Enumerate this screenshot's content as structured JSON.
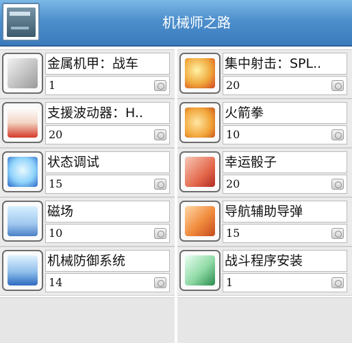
{
  "window": {
    "title": "机械师之路"
  },
  "skills": [
    {
      "name": "金属机甲：战车",
      "level": "1",
      "icon": "metal-mech-tank-icon",
      "colors": [
        "#e9e9e9",
        "#5a5a5a"
      ]
    },
    {
      "name": "集中射击：SPL..",
      "level": "20",
      "icon": "focused-shot-icon",
      "colors": [
        "#f8c34a",
        "#d2441f"
      ]
    },
    {
      "name": "支援波动器：H..",
      "level": "20",
      "icon": "support-wave-icon",
      "colors": [
        "#f7e7d8",
        "#d53a2a"
      ]
    },
    {
      "name": "火箭拳",
      "level": "10",
      "icon": "rocket-punch-icon",
      "colors": [
        "#ffe7a3",
        "#e07b21"
      ]
    },
    {
      "name": "状态调试",
      "level": "15",
      "icon": "status-debug-icon",
      "colors": [
        "#a9e4ff",
        "#2a67c8"
      ]
    },
    {
      "name": "幸运骰子",
      "level": "20",
      "icon": "lucky-dice-icon",
      "colors": [
        "#f6c8b8",
        "#cf3b2d"
      ]
    },
    {
      "name": "磁场",
      "level": "10",
      "icon": "magnetic-field-icon",
      "colors": [
        "#d8f0ff",
        "#4b80c7"
      ]
    },
    {
      "name": "导航辅助导弹",
      "level": "15",
      "icon": "homing-missile-icon",
      "colors": [
        "#ffd8a6",
        "#e0622a"
      ]
    },
    {
      "name": "机械防御系统",
      "level": "14",
      "icon": "defense-system-icon",
      "colors": [
        "#bfe1ff",
        "#2e6bc0"
      ]
    },
    {
      "name": "战斗程序安装",
      "level": "1",
      "icon": "battle-program-icon",
      "colors": [
        "#bff0c9",
        "#2a8c4d"
      ]
    }
  ]
}
